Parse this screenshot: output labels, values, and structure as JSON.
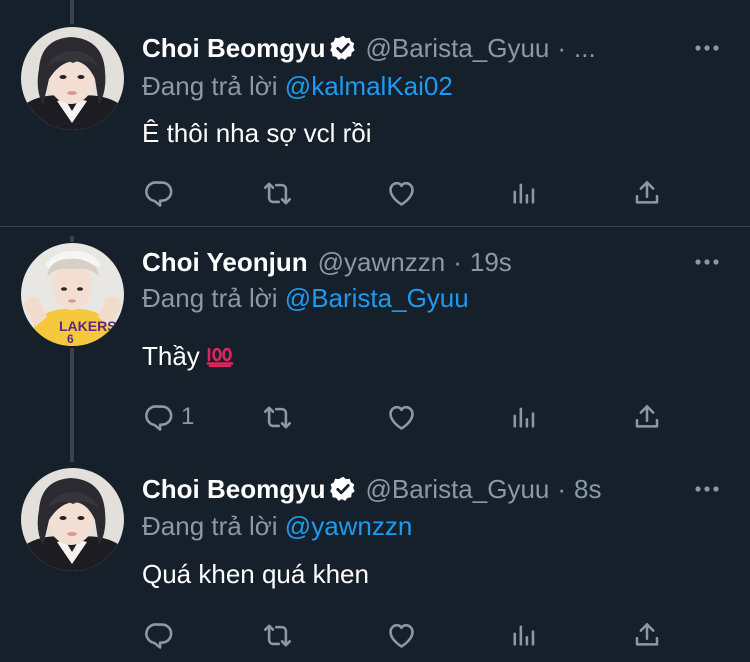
{
  "tweets": [
    {
      "display_name": "Choi Beomgyu",
      "verified": true,
      "handle": "@Barista_Gyuu",
      "time": "...",
      "reply_prefix": "Đang trả lời",
      "reply_to": "@kalmalKai02",
      "text": "Ê thôi nha sợ vcl rồi",
      "reply_count": ""
    },
    {
      "display_name": "Choi Yeonjun",
      "verified": false,
      "handle": "@yawnzzn",
      "time": "19s",
      "reply_prefix": "Đang trả lời",
      "reply_to": "@Barista_Gyuu",
      "text": "Thầy",
      "emoji": "hundred-points-emoji",
      "reply_count": "1"
    },
    {
      "display_name": "Choi Beomgyu",
      "verified": true,
      "handle": "@Barista_Gyuu",
      "time": "8s",
      "reply_prefix": "Đang trả lời",
      "reply_to": "@yawnzzn",
      "text": "Quá khen quá khen",
      "reply_count": ""
    }
  ],
  "separator": "·",
  "colors": {
    "background": "#15202b",
    "primary_text": "#ffffff",
    "secondary_text": "#8b98a5",
    "link": "#1d9bf0",
    "verified_badge": "#ffffff",
    "divider": "#38444d"
  },
  "icons": [
    "verified-badge-icon",
    "more-options-icon",
    "reply-icon",
    "retweet-icon",
    "like-icon",
    "analytics-icon",
    "share-icon"
  ]
}
